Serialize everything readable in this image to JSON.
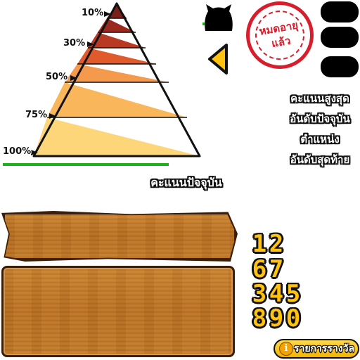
{
  "pyramid": {
    "tiers": [
      {
        "label": "10%",
        "color": "#7b1f1a"
      },
      {
        "label": "30%",
        "color": "#b83a22"
      },
      {
        "label": "50%",
        "color": "#e05a2c"
      },
      {
        "label": "75%",
        "color": "#f59a4c"
      },
      {
        "label": "100%",
        "color": "#fbc25e"
      }
    ],
    "base_tier_color": "#fde07c"
  },
  "labels": {
    "current_score": "คะแนนปัจจุบัน",
    "high_score": "คะแนนสูงสุด",
    "current_rank": "อันดับปัจจุบัน",
    "position": "ตำแหน่ง",
    "last_rank": "อันดับสุดท้าย"
  },
  "stamp": {
    "line1": "หมดอายุ",
    "line2": "แล้ว",
    "color": "#d81e2c"
  },
  "digits": {
    "rows": [
      [
        "1",
        "2"
      ],
      [
        "6",
        "7"
      ],
      [
        "3",
        "4",
        "5"
      ],
      [
        "8",
        "9",
        "0"
      ]
    ],
    "color": "#ffc20e"
  },
  "rewards_button": {
    "icon": "info-icon",
    "info_glyph": "i",
    "label": "รายการรางวัล"
  },
  "icons": {
    "cat": "cat-silhouette-icon",
    "back": "arrow-left-icon"
  }
}
